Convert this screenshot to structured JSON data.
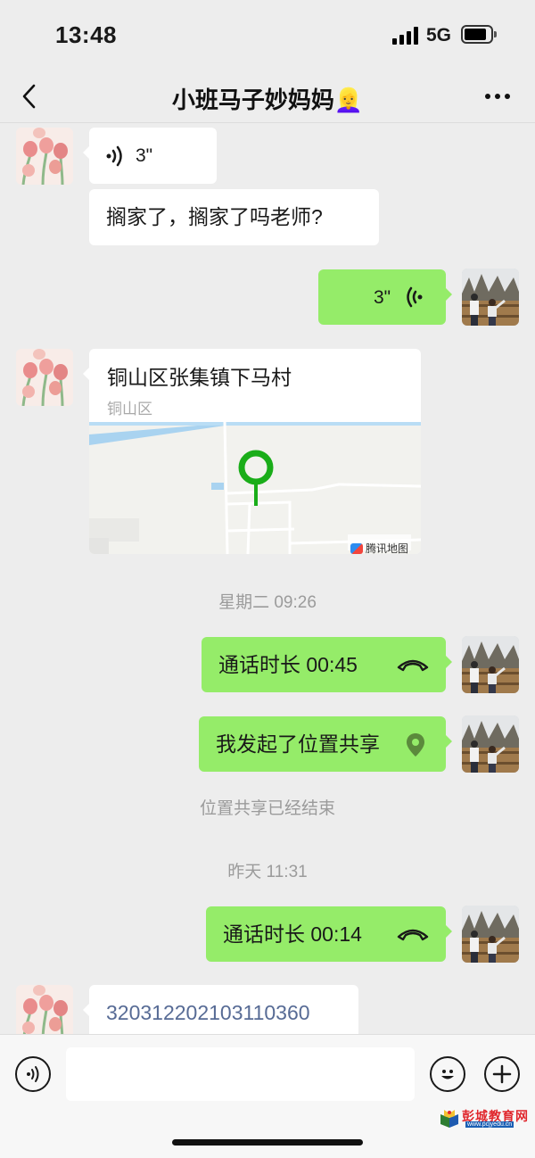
{
  "status_bar": {
    "time": "13:48",
    "network": "5G"
  },
  "nav": {
    "title": "小班马子妙妈妈👱‍♀️"
  },
  "messages": {
    "m1_voice_duration": "3\"",
    "m2_text": "搁家了，搁家了吗老师?",
    "m3_voice_duration": "3\"",
    "m4_location": {
      "title": "铜山区张集镇下马村",
      "subtitle": "铜山区",
      "map_provider": "腾讯地图"
    },
    "sys1": "星期二 09:26",
    "m5_call": "通话时长 00:45",
    "m6_location_share": "我发起了位置共享",
    "sys2": "位置共享已经结束",
    "sys3": "昨天 11:31",
    "m7_call": "通话时长 00:14",
    "m8_text": "320312202103110360"
  },
  "watermark": {
    "text": "彭城教育网",
    "url": "www.pcjyedu.cn"
  },
  "colors": {
    "background": "#ededed",
    "sent_bubble": "#95ec69",
    "received_bubble": "#ffffff",
    "map_pin": "#1aad19",
    "link_number": "#576b95"
  }
}
